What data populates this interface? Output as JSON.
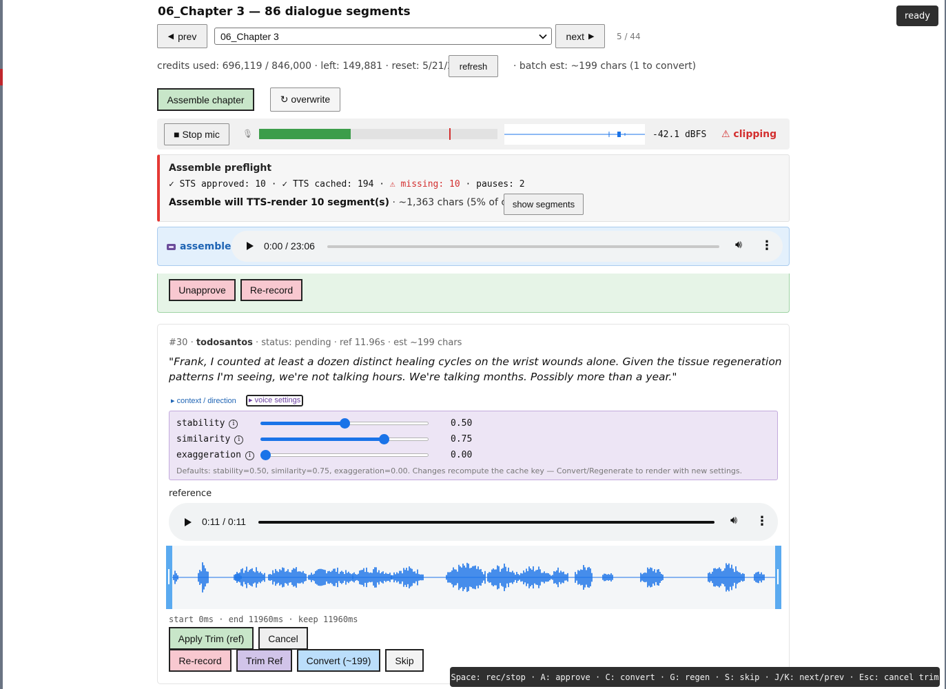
{
  "page": {
    "title": "06_Chapter 3 — 86 dialogue segments"
  },
  "nav": {
    "prev_label": "prev",
    "prev_icon": "triangle-left-icon",
    "chapter_selected": "06_Chapter 3",
    "next_label": "next",
    "next_icon": "triangle-right-icon",
    "counter": "5 / 44"
  },
  "credits": {
    "text": "credits used: 696,119 / 846,000 · left: 149,881 · reset: 5/21/2026",
    "refresh_label": "refresh",
    "batch_text": "· batch est: ~199 chars (1 to convert)"
  },
  "actions": {
    "assemble_label": "Assemble chapter",
    "overwrite_label": "↻ overwrite"
  },
  "mic": {
    "stop_label": "■ Stop mic",
    "level_fraction": 0.385,
    "peak_fraction": 0.797,
    "dbfs": "-42.1 dBFS",
    "clipping": "⚠ clipping",
    "colors": {
      "level": "#3c9d4a",
      "peak": "#d32f2f",
      "wave": "#1a73e8"
    }
  },
  "preflight": {
    "title": "Assemble preflight",
    "stats_ok": "✓ STS approved: 10 · ✓ TTS cached: 194 · ",
    "stats_missing": "⚠ missing: 10",
    "stats_tail": " · pauses: 2",
    "summary_bold": "Assemble will TTS-render 10 segment(s)",
    "summary_rest": " · ~1,363 chars (5% of chapter)",
    "show_segments_label": "show segments"
  },
  "assembled": {
    "label": "assembled",
    "time": "0:00 / 23:06",
    "progress_fraction": 0
  },
  "approved": {
    "unapprove_label": "Unapprove",
    "rerecord_label": "Re-record"
  },
  "segment": {
    "number": "#30",
    "speaker": "todosantos",
    "meta_rest": " · status: pending · ref 11.96s · est ~199 chars",
    "text": "\"Frank, I counted at least a dozen distinct healing cycles on the wrist wounds alone. Given the tissue regeneration patterns I'm seeing, we're not talking hours. We're talking months. Possibly more than a year.\"",
    "context_link": "▸ context / direction",
    "voice_toggle": "▸ voice settings"
  },
  "voice": {
    "sliders": [
      {
        "label": "stability",
        "value": 0.5,
        "display": "0.50"
      },
      {
        "label": "similarity",
        "value": 0.75,
        "display": "0.75"
      },
      {
        "label": "exaggeration",
        "value": 0.0,
        "display": "0.00"
      }
    ],
    "defaults_note": "Defaults: stability=0.50, similarity=0.75, exaggeration=0.00. Changes recompute the cache key — Convert/Regenerate to render with new settings."
  },
  "reference": {
    "label": "reference",
    "time": "0:11 / 0:11",
    "progress_fraction": 1.0,
    "trim_info": "start 0ms · end 11960ms · keep 11960ms"
  },
  "buttons": {
    "apply_trim": "Apply Trim (ref)",
    "cancel": "Cancel",
    "rerecord": "Re-record",
    "trim_ref": "Trim Ref",
    "convert": "Convert (~199)",
    "skip": "Skip"
  },
  "status": {
    "ready": "ready"
  },
  "shortcuts": "Space: rec/stop · A: approve · C: convert · G: regen · S: skip · J/K: next/prev · Esc: cancel trim"
}
